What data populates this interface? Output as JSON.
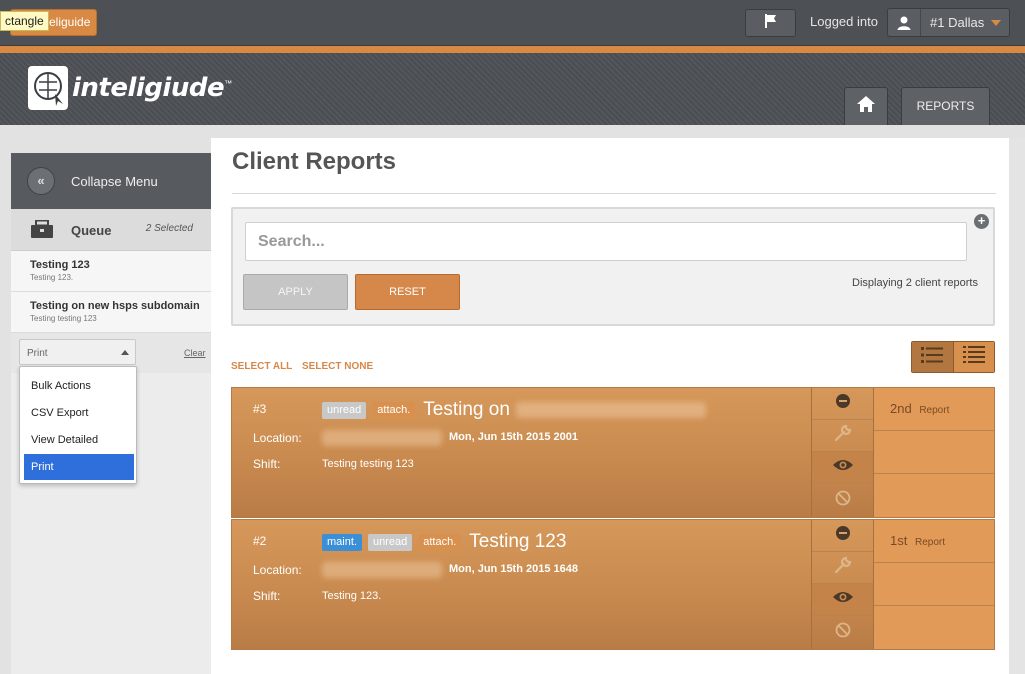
{
  "topbar": {
    "tooltip": "ctangle",
    "logo_button_label": "eliguide",
    "logged_label": "Logged into",
    "user_name": "#1 Dallas"
  },
  "header": {
    "brand_name": "inteligiude",
    "brand_tm": "™",
    "reports_label": "REPORTS"
  },
  "sidebar": {
    "collapse_label": "Collapse Menu",
    "collapse_icon": "«",
    "queue_label": "Queue",
    "queue_count": "2 Selected",
    "items": [
      {
        "title": "Testing 123",
        "subtitle": "Testing 123."
      },
      {
        "title": "Testing on new hsps subdomain",
        "subtitle": "Testing testing 123"
      }
    ],
    "select_value": "Print",
    "clear_label": "Clear",
    "options": [
      "Bulk Actions",
      "CSV Export",
      "View Detailed",
      "Print"
    ]
  },
  "main": {
    "title": "Client Reports",
    "search_placeholder": "Search...",
    "apply_label": "APPLY",
    "reset_label": "RESET",
    "display_count": "Displaying 2 client reports",
    "select_all": "SELECT ALL",
    "select_none": "SELECT NONE",
    "plus_icon": "+"
  },
  "reports": [
    {
      "num": "#3",
      "tags": [
        "unread",
        "attach."
      ],
      "title": "Testing on",
      "location_label": "Location:",
      "date": "Mon, Jun 15th 2015 2001",
      "shift_label": "Shift:",
      "shift": "Testing testing 123",
      "rank": "2nd",
      "rank_label": "Report"
    },
    {
      "num": "#2",
      "tags": [
        "maint.",
        "unread",
        "attach."
      ],
      "title": "Testing 123",
      "location_label": "Location:",
      "date": "Mon, Jun 15th 2015 1648",
      "shift_label": "Shift:",
      "shift": "Testing 123.",
      "rank": "1st",
      "rank_label": "Report"
    }
  ],
  "colors": {
    "accent": "#d88a45",
    "topbar": "#4d5156",
    "selected_option": "#2f6fdb",
    "maint_tag": "#3a8fd6"
  },
  "icons": {
    "flag": "flag-icon",
    "user": "user-icon",
    "home": "home-icon",
    "queue": "queue-box-icon",
    "list_view": "list-view-icon",
    "compact_view": "compact-list-icon",
    "remove": "minus-circle-icon",
    "wrench": "wrench-icon",
    "eye": "eye-icon",
    "block": "block-icon"
  }
}
